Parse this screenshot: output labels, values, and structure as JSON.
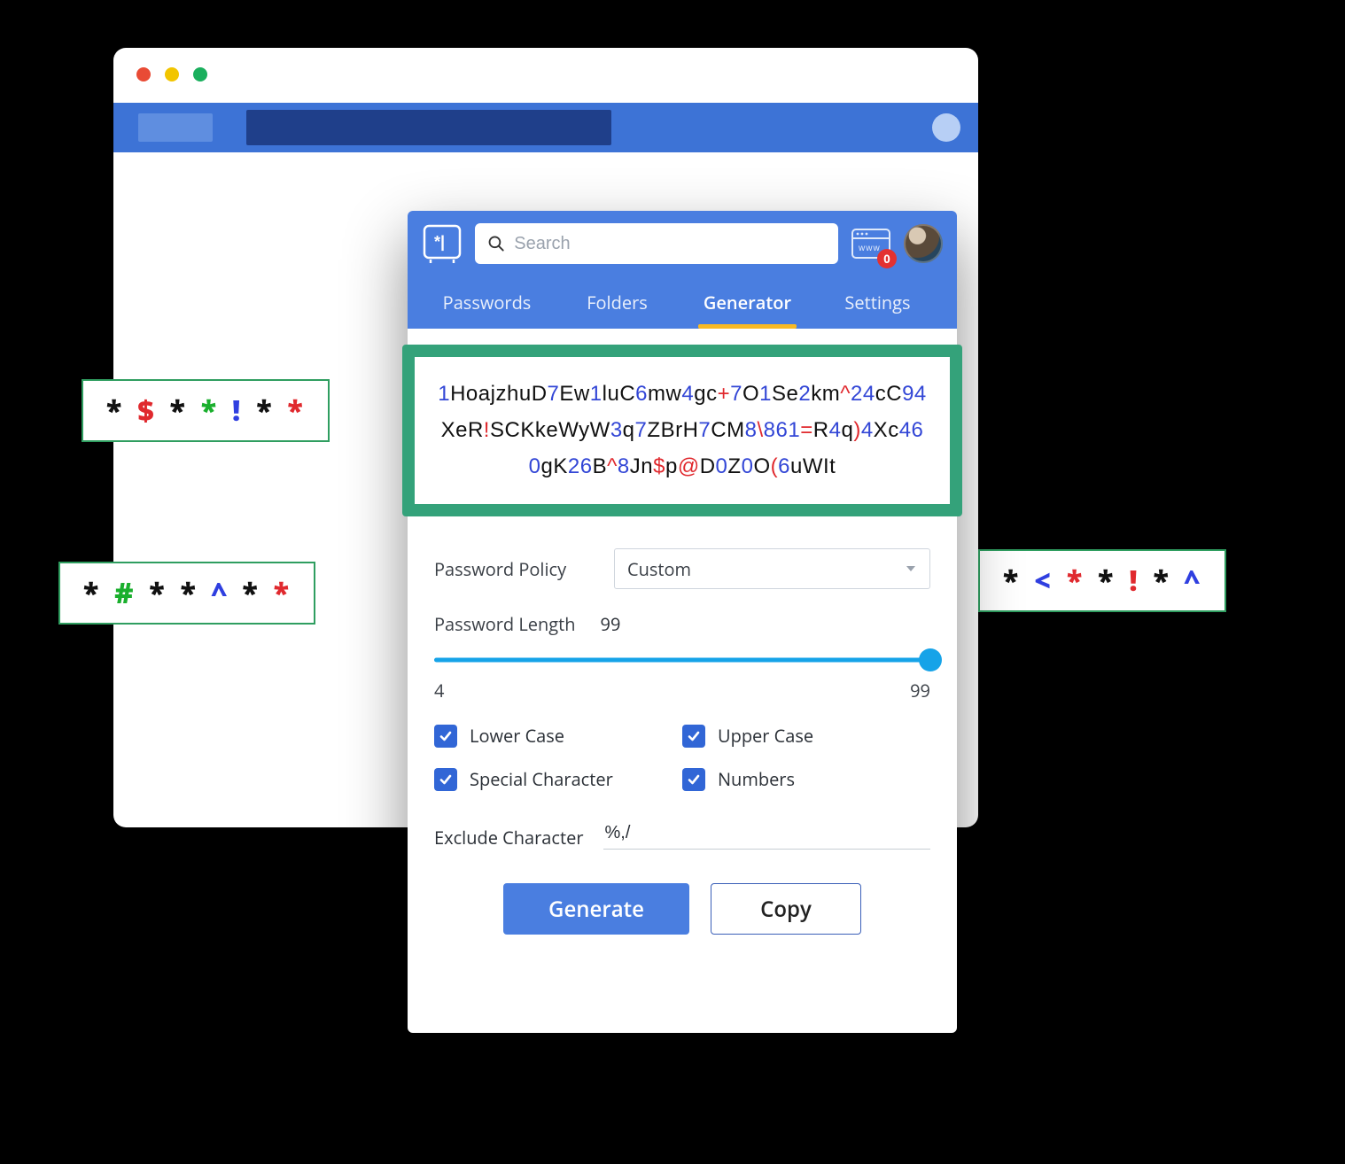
{
  "colors": {
    "accent_blue": "#4a7ee0",
    "slider_blue": "#16a3e8",
    "highlight_green": "#34a27a",
    "badge_red": "#e33131",
    "tab_underline": "#f8b924"
  },
  "browser": {
    "dots": [
      "red",
      "yellow",
      "green"
    ]
  },
  "decor_badges": {
    "a": [
      {
        "t": "*",
        "c": ""
      },
      {
        "t": "$",
        "c": "red"
      },
      {
        "t": "*",
        "c": ""
      },
      {
        "t": "*",
        "c": "grn"
      },
      {
        "t": "!",
        "c": "blu"
      },
      {
        "t": "*",
        "c": ""
      },
      {
        "t": "*",
        "c": "red"
      }
    ],
    "b": [
      {
        "t": "*",
        "c": ""
      },
      {
        "t": "#",
        "c": "grn"
      },
      {
        "t": "*",
        "c": ""
      },
      {
        "t": "*",
        "c": ""
      },
      {
        "t": "^",
        "c": "blu"
      },
      {
        "t": "*",
        "c": ""
      },
      {
        "t": "*",
        "c": "red"
      }
    ],
    "c": [
      {
        "t": "*",
        "c": ""
      },
      {
        "t": "<",
        "c": "blu"
      },
      {
        "t": "*",
        "c": "red"
      },
      {
        "t": "*",
        "c": ""
      },
      {
        "t": "!",
        "c": "red"
      },
      {
        "t": "*",
        "c": ""
      },
      {
        "t": "^",
        "c": "blu"
      }
    ]
  },
  "header": {
    "search_placeholder": "Search",
    "web_badge_count": "0",
    "tabs": [
      {
        "label": "Passwords",
        "active": false
      },
      {
        "label": "Folders",
        "active": false
      },
      {
        "label": "Generator",
        "active": true
      },
      {
        "label": "Settings",
        "active": false
      }
    ]
  },
  "generated_password": "1HoajzhuD7Ew1luC6mw4gc+7O1Se2km^24cC94XeR!SCKkeWyW3q7ZBrH7CM8\\861=R4q)4Xc460gK26B^8Jn$p@D0Z0O(6uWIt",
  "form": {
    "policy_label": "Password Policy",
    "policy_value": "Custom",
    "length_label": "Password Length",
    "length_value": "99",
    "slider_min": "4",
    "slider_max": "99",
    "options": {
      "lower": "Lower Case",
      "upper": "Upper Case",
      "special": "Special Character",
      "numbers": "Numbers"
    },
    "exclude_label": "Exclude Character",
    "exclude_value": "%,/",
    "generate_btn": "Generate",
    "copy_btn": "Copy"
  }
}
